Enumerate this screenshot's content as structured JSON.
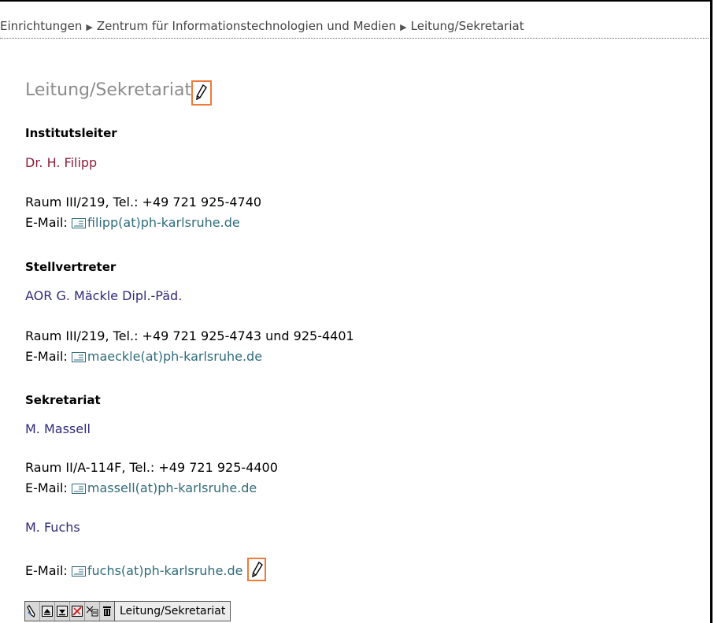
{
  "breadcrumb": {
    "items": [
      "Einrichtungen",
      "Zentrum für Informationstechnologien und Medien",
      "Leitung/Sekretariat"
    ]
  },
  "page": {
    "title": "Leitung/Sekretariat"
  },
  "sections": {
    "leiter": {
      "heading": "Institutsleiter",
      "name": "Dr. H. Filipp",
      "room": "Raum III/219, Tel.: +49 721 925-4740",
      "email_label": "E-Mail:",
      "email": "filipp(at)ph-karlsruhe.de"
    },
    "vertreter": {
      "heading": "Stellvertreter",
      "name": "AOR G. Mäckle Dipl.-Päd.",
      "room": "Raum III/219, Tel.: +49 721 925-4743 und 925-4401",
      "email_label": "E-Mail:",
      "email": "maeckle(at)ph-karlsruhe.de"
    },
    "sekretariat": {
      "heading": "Sekretariat",
      "name1": "M. Massell",
      "room1": "Raum II/A-114F, Tel.: +49 721 925-4400",
      "email_label": "E-Mail:",
      "email1": "massell(at)ph-karlsruhe.de",
      "name2": "M. Fuchs",
      "email2": "fuchs(at)ph-karlsruhe.de"
    }
  },
  "toolbar": {
    "buttons": [
      "edit-icon",
      "move-up-icon",
      "move-down-icon",
      "hide-icon",
      "cut-icon",
      "delete-icon"
    ],
    "label": "Leitung/Sekretariat"
  },
  "colors": {
    "edit_highlight": "#f07a3a",
    "link": "#2e6b7a",
    "name_red": "#8b1f3a",
    "name_blue": "#2f2a7a",
    "title_gray": "#8c8c8c"
  }
}
